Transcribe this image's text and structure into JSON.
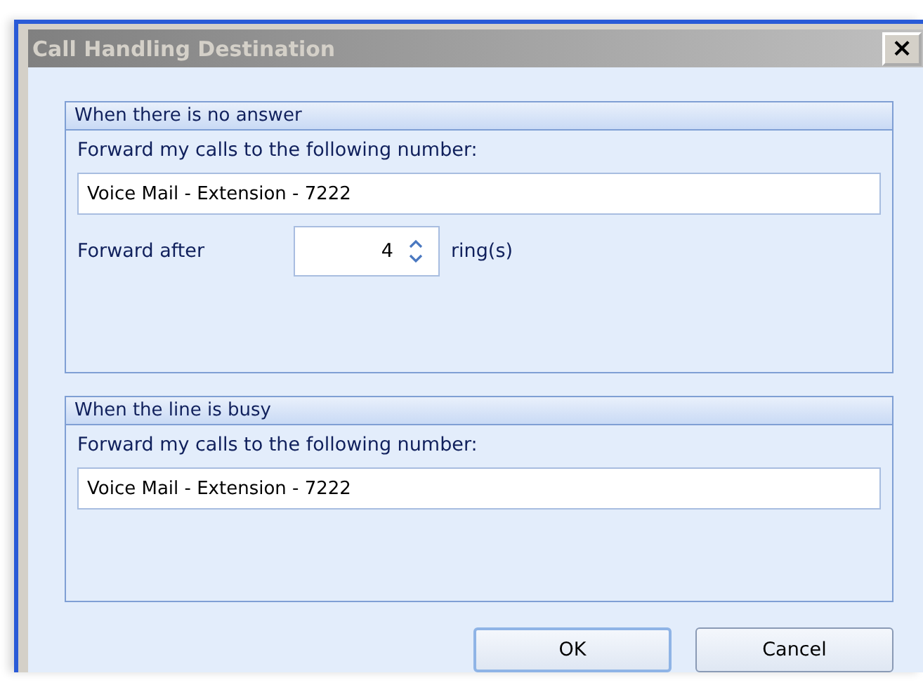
{
  "window": {
    "title": "Call Handling Destination",
    "close_label": "×"
  },
  "groups": [
    {
      "title": "When there is no answer",
      "prompt": "Forward my calls to the following number:",
      "destination": "Voice Mail - Extension - 7222",
      "rings": {
        "label": "Forward after",
        "value": "4",
        "unit": "ring(s)"
      }
    },
    {
      "title": "When the line is busy",
      "prompt": "Forward my calls to the following number:",
      "destination": "Voice Mail - Extension - 7222"
    }
  ],
  "buttons": [
    {
      "label": "OK",
      "default": true
    },
    {
      "label": "Cancel",
      "default": false
    }
  ]
}
